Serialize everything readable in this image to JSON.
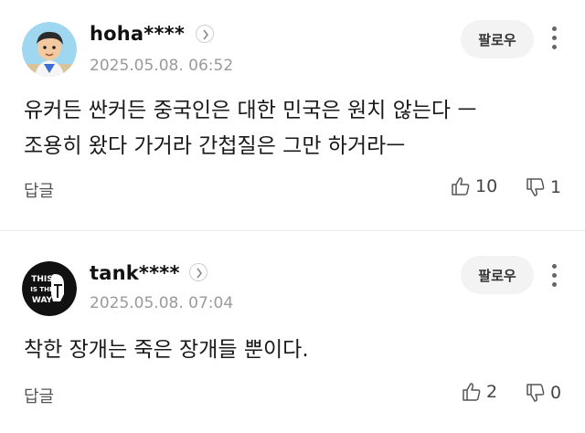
{
  "comments": [
    {
      "username": "hoha****",
      "timestamp": "2025.05.08. 06:52",
      "follow_label": "팔로우",
      "text_lines": [
        "유커든 싼커든 중국인은 대한 민국은 원치 않는다 ㅡ",
        "조용히 왔다 가거라 간첩질은 그만 하거라ㅡ"
      ],
      "reply_label": "답글",
      "likes": "10",
      "dislikes": "1",
      "avatar_icon": "cartoon-person-avatar"
    },
    {
      "username": "tank****",
      "timestamp": "2025.05.08. 07:04",
      "follow_label": "팔로우",
      "text_lines": [
        "착한 장개는 죽은 장개들 뿐이다."
      ],
      "reply_label": "답글",
      "likes": "2",
      "dislikes": "0",
      "avatar_icon": "this-is-the-way-logo",
      "avatar_text": [
        "THIS",
        "IS THE",
        "WAY"
      ]
    }
  ],
  "colors": {
    "background": "#ffffff",
    "follow_button_bg": "#f3f3f3",
    "muted_text": "#9a9a9a"
  }
}
